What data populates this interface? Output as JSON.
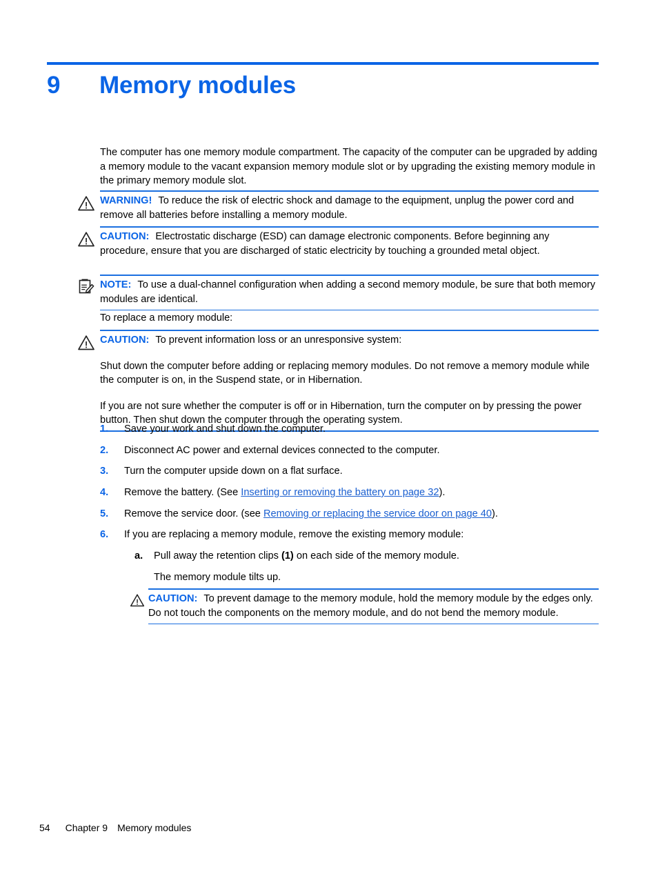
{
  "colors": {
    "accent_blue": "#0a64e6",
    "rule_blue": "#1a6fe0",
    "link_blue": "#1a5fd0",
    "text_black": "#000000",
    "page_background": "#ffffff"
  },
  "chapter": {
    "number": "9",
    "title": "Memory modules"
  },
  "intro": {
    "paragraph": "The computer has one memory module compartment. The capacity of the computer can be upgraded by adding a memory module to the vacant expansion memory module slot or by upgrading the existing memory module in the primary memory module slot."
  },
  "admonitions": {
    "warning_power": {
      "icon": "warning-triangle-icon",
      "label": "WARNING!",
      "text": "To reduce the risk of electric shock and damage to the equipment, unplug the power cord and remove all batteries before installing a memory module."
    },
    "caution_esd": {
      "icon": "warning-triangle-icon",
      "label": "CAUTION:",
      "text": "Electrostatic discharge (ESD) can damage electronic components. Before beginning any procedure, ensure that you are discharged of static electricity by touching a grounded metal object."
    },
    "note_dual_channel": {
      "icon": "note-clipboard-pencil-icon",
      "label": "NOTE:",
      "text": "To use a dual-channel configuration when adding a second memory module, be sure that both memory modules are identical."
    },
    "caution_data_loss": {
      "icon": "warning-triangle-icon",
      "label": "CAUTION:",
      "text": "To prevent information loss or an unresponsive system:",
      "paragraph_1": "Shut down the computer before adding or replacing memory modules. Do not remove a memory module while the computer is on, in the Suspend state, or in Hibernation.",
      "paragraph_2": "If you are not sure whether the computer is off or in Hibernation, turn the computer on by pressing the power button. Then shut down the computer through the operating system."
    },
    "caution_handle_edges": {
      "icon": "warning-triangle-icon",
      "label": "CAUTION:",
      "text": "To prevent damage to the memory module, hold the memory module by the edges only. Do not touch the components on the memory module, and do not bend the memory module."
    }
  },
  "lead_in": {
    "text": "To replace a memory module:"
  },
  "steps": [
    {
      "marker": "1.",
      "text": "Save your work and shut down the computer."
    },
    {
      "marker": "2.",
      "text": "Disconnect AC power and external devices connected to the computer."
    },
    {
      "marker": "3.",
      "text": "Turn the computer upside down on a flat surface."
    },
    {
      "marker": "4.",
      "prefix": "Remove the battery. (See ",
      "link": "Inserting or removing the battery on page 32",
      "suffix": ")."
    },
    {
      "marker": "5.",
      "prefix": "Remove the service door. (see ",
      "link": "Removing or replacing the service door on page 40",
      "suffix": ")."
    },
    {
      "marker": "6.",
      "text": "If you are replacing a memory module, remove the existing memory module:"
    }
  ],
  "substeps": [
    {
      "marker": "a.",
      "prefix": "Pull away the retention clips ",
      "callout": "(1)",
      "suffix": " on each side of the memory module."
    }
  ],
  "substep_note": {
    "text": "The memory module tilts up."
  },
  "footer": {
    "page_number": "54",
    "chapter_label": "Chapter 9",
    "chapter_title": "Memory modules"
  }
}
